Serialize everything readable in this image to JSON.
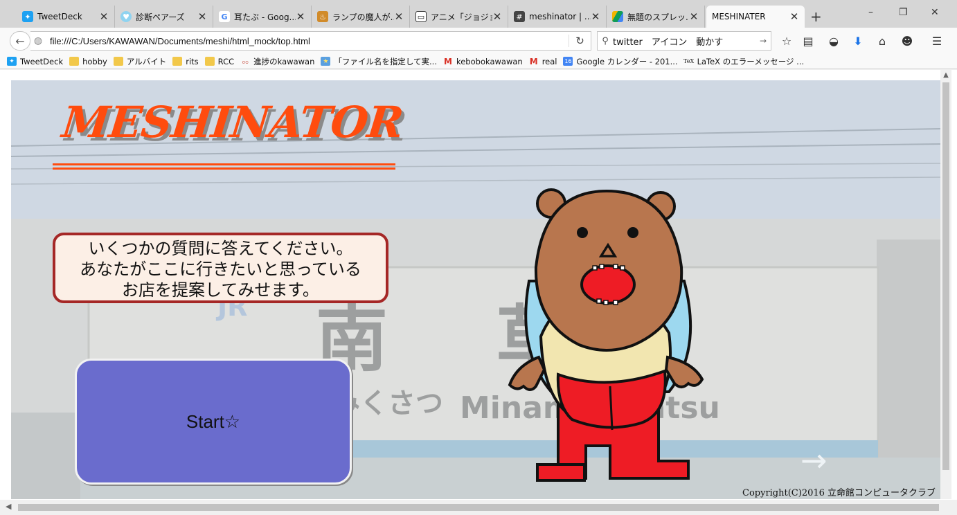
{
  "browser": {
    "tabs": [
      {
        "title": "TweetDeck",
        "icon": "tweetdeck-icon"
      },
      {
        "title": "診断ペアーズ",
        "icon": "heart-icon"
      },
      {
        "title": "耳たぶ - Goog...",
        "icon": "google-icon"
      },
      {
        "title": "ランプの魔人が...",
        "icon": "lamp-icon"
      },
      {
        "title": "アニメ「ジョジョ...",
        "icon": "tv-icon"
      },
      {
        "title": "meshinator | ...",
        "icon": "slack-icon"
      },
      {
        "title": "無題のスプレッ...",
        "icon": "drive-icon"
      },
      {
        "title": "MESHINATER",
        "icon": "blank-page-icon",
        "active": true
      }
    ],
    "new_tab": "+",
    "window_controls": {
      "minimize": "–",
      "restore": "❐",
      "close": "✕"
    },
    "url": "file:///C:/Users/KAWAWAN/Documents/meshi/html_mock/top.html",
    "search_value": "twitter　アイコン　動かす",
    "bookmarks": [
      {
        "label": "TweetDeck",
        "icon": "tweetdeck-icon"
      },
      {
        "label": "hobby",
        "icon": "folder-icon"
      },
      {
        "label": "アルバイト",
        "icon": "folder-icon"
      },
      {
        "label": "rits",
        "icon": "folder-icon"
      },
      {
        "label": "RCC",
        "icon": "folder-icon"
      },
      {
        "label": "進捗のkawawan",
        "icon": "mascot-icon"
      },
      {
        "label": "「ファイル名を指定して実...",
        "icon": "star-icon"
      },
      {
        "label": "kebobokawawan",
        "icon": "gmail-icon"
      },
      {
        "label": "real",
        "icon": "gmail-icon"
      },
      {
        "label": "Google カレンダー - 201...",
        "icon": "calendar-icon"
      },
      {
        "label": "LaTeX のエラーメッセージ ...",
        "icon": "tex-icon"
      }
    ]
  },
  "page": {
    "logo": "MESHINATOR",
    "message_lines": [
      "いくつかの質問に答えてください。",
      "あなたがここに行きたいと思っている",
      "お店を提案してみせます。"
    ],
    "start_label": "Start☆",
    "copyright": "Copyright(C)2016 立命館コンピュータクラブ",
    "background_sign": {
      "kanji": "南 草",
      "kana": "みなみくさつ",
      "romaji": "Minamikusatsu",
      "jr": "JR"
    }
  },
  "colors": {
    "logo": "#ff4c0e",
    "logo_shadow": "#8a8a8a",
    "message_border": "#a52726",
    "message_bg": "#fcefe6",
    "start_button": "#6a6ccd",
    "mascot_head": "#b8764e",
    "mascot_suit": "#ee1c25",
    "mascot_belly": "#f2e6b0",
    "mascot_cape": "#9dd8ef"
  }
}
